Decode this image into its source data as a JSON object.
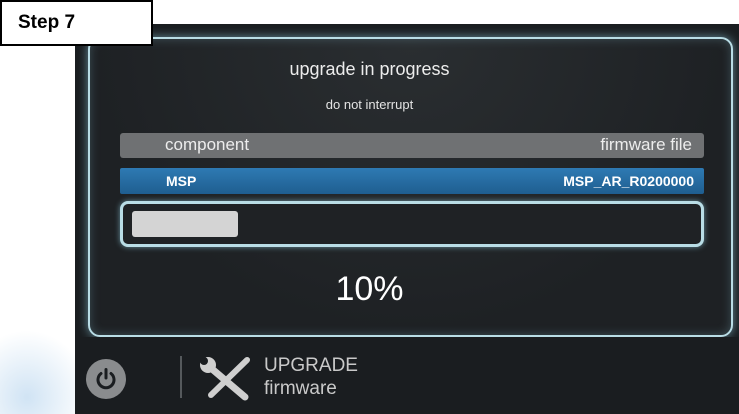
{
  "step_label": "Step 7",
  "panel": {
    "title": "upgrade in progress",
    "subtitle": "do not interrupt",
    "table": {
      "headers": {
        "component": "component",
        "firmware_file": "firmware file"
      },
      "rows": [
        {
          "component": "MSP",
          "firmware_file": "MSP_AR_R0200000"
        }
      ]
    },
    "progress_fraction": 0.19,
    "percent_text": "10%"
  },
  "footer": {
    "power_icon": "power-icon",
    "tools_icon": "wrench-screwdriver-icon",
    "upgrade_line1": "UPGRADE",
    "upgrade_line2": "firmware"
  },
  "colors": {
    "accent_glow": "#b9dde6",
    "selected_row": "#2a6fa5",
    "header_row": "#6f7173",
    "background": "#1a1d20"
  }
}
